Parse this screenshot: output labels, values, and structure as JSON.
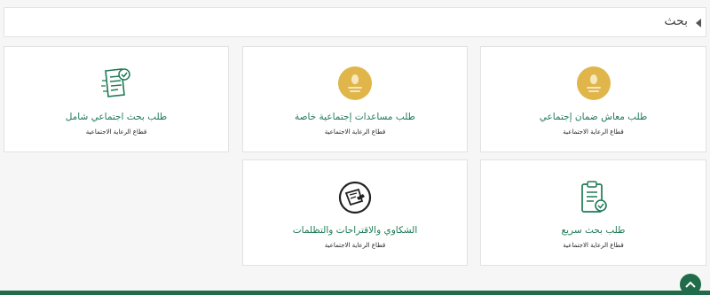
{
  "search": {
    "title": "بحث"
  },
  "cards": [
    {
      "label": "طلب بحث اجتماعي شامل",
      "sub": "قطاع الرعاية الاجتماعية"
    },
    {
      "label": "طلب مساعدات إجتماعية خاصة",
      "sub": "قطاع الرعاية الاجتماعية"
    },
    {
      "label": "طلب معاش ضمان إجتماعي",
      "sub": "قطاع الرعاية الاجتماعية"
    },
    {
      "label": "الشكاوي والاقتراحات والتظلمات",
      "sub": "قطاع الرعاية الاجتماعية"
    },
    {
      "label": "طلب بحث سريع",
      "sub": "قطاع الرعاية الاجتماعية"
    }
  ],
  "colors": {
    "accent": "#1f7a56",
    "gold": "#e0b64b",
    "footer": "#1f6b4a"
  },
  "icons": [
    "clipboard-check-icon",
    "gold-coin-icon",
    "complaint-circle-icon",
    "scroll-top-icon",
    "collapse-caret-icon"
  ]
}
